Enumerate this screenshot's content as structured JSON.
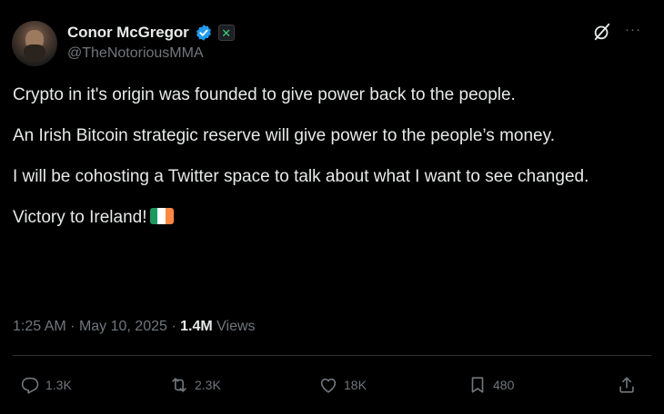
{
  "author": {
    "name": "Conor McGregor",
    "handle": "@TheNotoriousMMA"
  },
  "tweet": {
    "paragraphs": [
      "Crypto in it's origin was founded to give power back to the people.",
      "An Irish Bitcoin strategic reserve will give power to the people’s money.",
      "I will be cohosting a Twitter space to talk about what I want to see changed.",
      "Victory to Ireland!"
    ]
  },
  "meta": {
    "time": "1:25 AM",
    "separator": "·",
    "date": "May 10, 2025",
    "views_count": "1.4M",
    "views_label": "Views"
  },
  "actions": {
    "replies": "1.3K",
    "reposts": "2.3K",
    "likes": "18K",
    "bookmarks": "480"
  },
  "colors": {
    "background": "#000000",
    "text": "#e7e9ea",
    "secondary": "#71767b",
    "verified": "#1d9bf0",
    "divider": "#2f3336"
  },
  "icons": {
    "verified": "verified-badge-icon",
    "affiliate": "affiliate-badge-icon",
    "grok": "grok-icon",
    "more": "more-icon",
    "reply": "reply-icon",
    "repost": "repost-icon",
    "like": "like-icon",
    "bookmark": "bookmark-icon",
    "share": "share-icon",
    "flag": "ireland-flag-icon"
  }
}
